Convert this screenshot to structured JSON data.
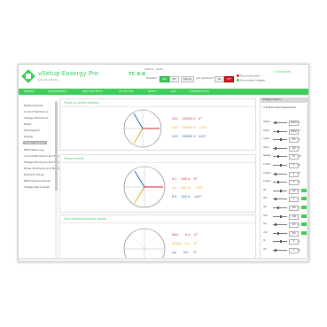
{
  "header": {
    "app_title": "vSetup Easergy Pro",
    "app_subtitle": "Schneider Electric",
    "device_name": "TC 4.0",
    "device_id": "GS8316 - 42530",
    "mode_label": "Simulation",
    "mode_on": "ON",
    "mode_off": "OFF",
    "settings_label": "Settings",
    "auto_label": "Auto adjustment",
    "auto_on": "ON",
    "auto_off": "OFF",
    "status_1": "Not synchronized",
    "status_2": "No simulated voltages",
    "configured": "Configured"
  },
  "menu": [
    "GENERAL",
    "MEASUREMENTS",
    "INPUTS/OUTPUTS",
    "PROTECTION",
    "MATRIX",
    "LOGS",
    "COMMUNICATION"
  ],
  "nav": {
    "items": [
      "Measurements",
      "Current Harmonics",
      "Voltage Harmonics",
      "Power",
      "PQ-Diagram",
      "Energy",
      "Phasor Diagram",
      "RMS Measuring",
      "Current Minimums and Maximu",
      "Voltage Minimums and Maxim",
      "Power Minimums and Maximum",
      "Demand Values",
      "RMS Demand Values",
      "Voltage Sag & Swell"
    ],
    "selected": "Phasor Diagram"
  },
  "panels": {
    "p1_title": "Phase-to-neutral voltages",
    "p1_rows": [
      {
        "name": "UL1",
        "value": "20000 V",
        "angle": "0°"
      },
      {
        "name": "UL2",
        "value": "20000 V",
        "angle": "-120°"
      },
      {
        "name": "UL3",
        "value": "20000 V",
        "angle": "120°"
      }
    ],
    "p2_title": "Phase currents",
    "p2_rows": [
      {
        "name": "IL1",
        "value": "100 A",
        "angle": "0°"
      },
      {
        "name": "IL2",
        "value": "100 A",
        "angle": "-120°"
      },
      {
        "name": "IL3",
        "value": "100 A",
        "angle": "120°"
      }
    ],
    "p3_title": "Zero sequence/residual signals",
    "p3_rows": [
      {
        "name": "I0e1",
        "value": "0 A",
        "angle": "0°"
      },
      {
        "name": "I0Calc",
        "value": "0 A",
        "angle": "0°"
      },
      {
        "name": "Uo",
        "value": "0%",
        "angle": "0°"
      }
    ]
  },
  "right_panel": {
    "title": "Voltage injection",
    "checkbox_label": "Enable virtual measurement",
    "rows": [
      {
        "label": "Umain",
        "value": "20000",
        "unit": "V"
      },
      {
        "label": "Umax",
        "value": "20000",
        "unit": "V"
      },
      {
        "label": "I,main",
        "value": "100",
        "unit": "A"
      },
      {
        "label": "Imain",
        "value": "100",
        "unit": "A"
      },
      {
        "label": "fsupply",
        "value": "50",
        "unit": "Hz"
      },
      {
        "label": "2 harm",
        "value": "0",
        "unit": "%"
      },
      {
        "label": "3 harm",
        "value": "0",
        "unit": "%"
      },
      {
        "label": "5 harm",
        "value": "0",
        "unit": "%"
      },
      {
        "label": "IL1",
        "value": "100",
        "unit": "A"
      },
      {
        "label": "UL1",
        "value": "0",
        "unit": "°"
      },
      {
        "label": "IL2",
        "value": "100",
        "unit": "A"
      },
      {
        "label": "UL2",
        "value": "-120",
        "unit": "°"
      },
      {
        "label": "IL3",
        "value": "100",
        "unit": "A"
      },
      {
        "label": "UL3",
        "value": "120",
        "unit": "°"
      },
      {
        "label": "I0",
        "value": "0",
        "unit": "A"
      },
      {
        "label": "U0",
        "value": "0",
        "unit": "%"
      }
    ]
  },
  "colors": {
    "brand_green": "#3dcd58",
    "phase1": "#d21f1f",
    "phase2": "#f0a020",
    "phase3": "#1f56b0"
  }
}
